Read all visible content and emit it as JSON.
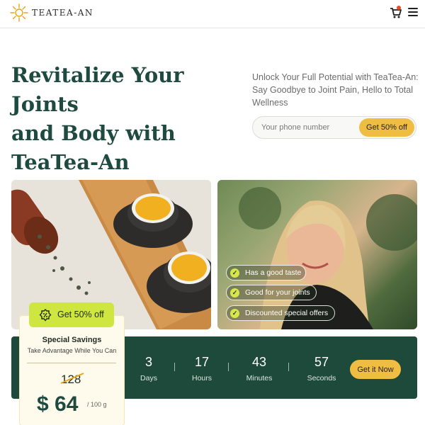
{
  "header": {
    "brand": "TEATEA-AN",
    "icons": [
      "sun-logo-icon",
      "cart-icon",
      "menu-icon"
    ],
    "accent": "#e84a2c"
  },
  "hero": {
    "title_lines": [
      "Revitalize Your Joints",
      "and Body with",
      "TeaTea-An"
    ],
    "subtitle": "Unlock Your Full Potential with TeaTea-An: Say Goodbye to Joint Pain, Hello to Total Wellness",
    "phone_placeholder": "Your phone number",
    "cta": "Get 50% off"
  },
  "benefits": [
    "Has a good taste",
    "Good for your joints",
    "Discounted special offers"
  ],
  "offer": {
    "badge": "Get 50% off",
    "title": "Special Savings",
    "subtitle": "Take Advantage While You Can",
    "old_price": "128",
    "price": "$ 64",
    "unit": "/ 100 g"
  },
  "countdown": {
    "items": [
      {
        "value": "3",
        "label": "Days"
      },
      {
        "value": "17",
        "label": "Hours"
      },
      {
        "value": "43",
        "label": "Minutes"
      },
      {
        "value": "57",
        "label": "Seconds"
      }
    ],
    "cta": "Get it Now"
  },
  "colors": {
    "primary": "#1e4a3c",
    "accent_yellow": "#f0bd43",
    "badge_lime": "#cfe640"
  }
}
